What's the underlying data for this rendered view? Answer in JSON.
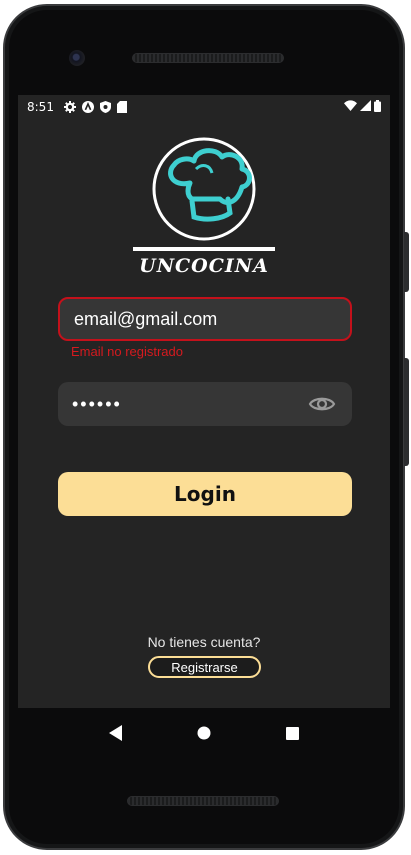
{
  "status": {
    "time": "8:51"
  },
  "brand": {
    "name": "UNCOCINA"
  },
  "form": {
    "email_value": "email@gmail.com",
    "email_error": "Email no registrado",
    "password_value": "••••••",
    "login_label": "Login"
  },
  "footer": {
    "prompt": "No tienes cuenta?",
    "register_label": "Registrarse"
  },
  "colors": {
    "background": "#242424",
    "field": "#363636",
    "error": "#d51a1f",
    "accent": "#fcde96",
    "logo_teal": "#3ecfd0"
  },
  "icons": {
    "statusbar": [
      "settings-icon",
      "a-circle-icon",
      "shield-icon",
      "sd-card-icon",
      "wifi-icon",
      "signal-icon",
      "battery-icon"
    ],
    "password_toggle": "eye-icon",
    "navigation": [
      "back-icon",
      "home-icon",
      "recents-icon"
    ]
  }
}
